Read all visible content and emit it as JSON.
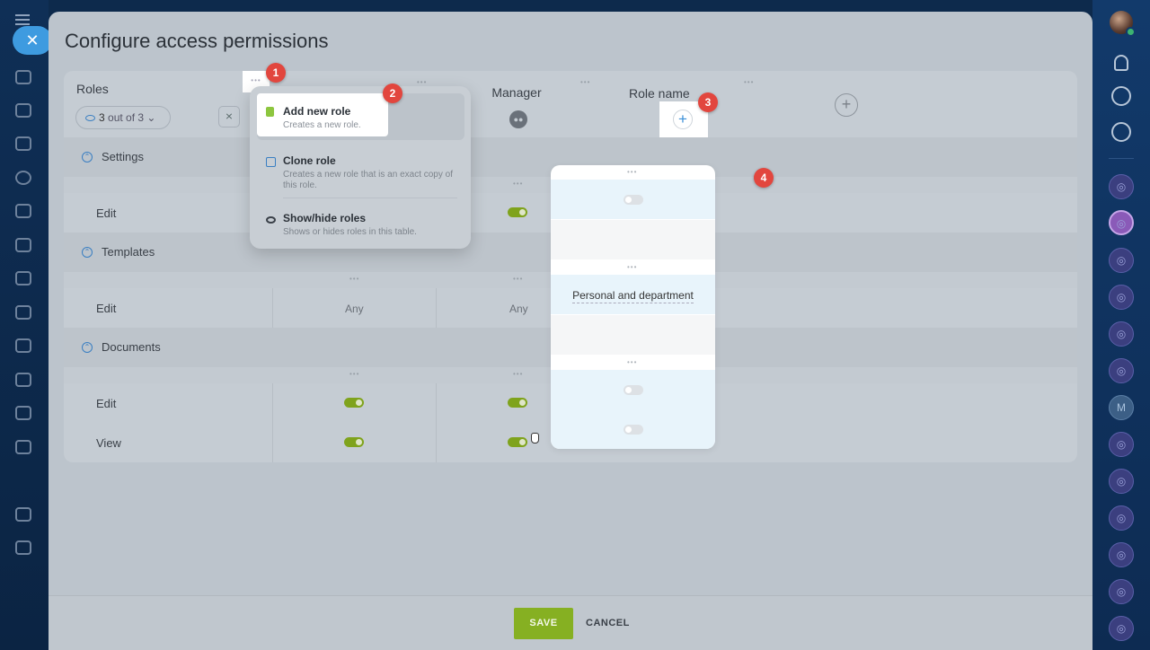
{
  "page_title": "Configure access permissions",
  "header": {
    "roles_label": "Roles",
    "visible_count": "3",
    "visible_suffix": "out of 3",
    "columns": [
      "Manager",
      "Role name"
    ]
  },
  "menu": {
    "items": [
      {
        "title": "Add new role",
        "desc": "Creates a new role."
      },
      {
        "title": "Clone role",
        "desc": "Creates a new role that is an exact copy of this role."
      },
      {
        "title": "Show/hide roles",
        "desc": "Shows or hides roles in this table."
      }
    ]
  },
  "sections": [
    {
      "name": "Settings",
      "rows": [
        {
          "label": "Edit"
        }
      ]
    },
    {
      "name": "Templates",
      "rows": [
        {
          "label": "Edit",
          "values": [
            "Any",
            "Any",
            "Personal and department"
          ]
        }
      ]
    },
    {
      "name": "Documents",
      "rows": [
        {
          "label": "Edit"
        },
        {
          "label": "View"
        }
      ]
    }
  ],
  "toggles": {
    "settings_edit": [
      true,
      false
    ],
    "documents_edit": [
      true,
      true,
      false
    ],
    "documents_view": [
      true,
      true,
      false
    ]
  },
  "callouts": [
    "1",
    "2",
    "3",
    "4"
  ],
  "right_sidebar": {
    "chat_letter": "M"
  },
  "footer": {
    "save": "SAVE",
    "cancel": "CANCEL"
  },
  "colors": {
    "accent_green": "#86b022",
    "badge_red": "#e2463e",
    "link_blue": "#3a8fd8"
  }
}
